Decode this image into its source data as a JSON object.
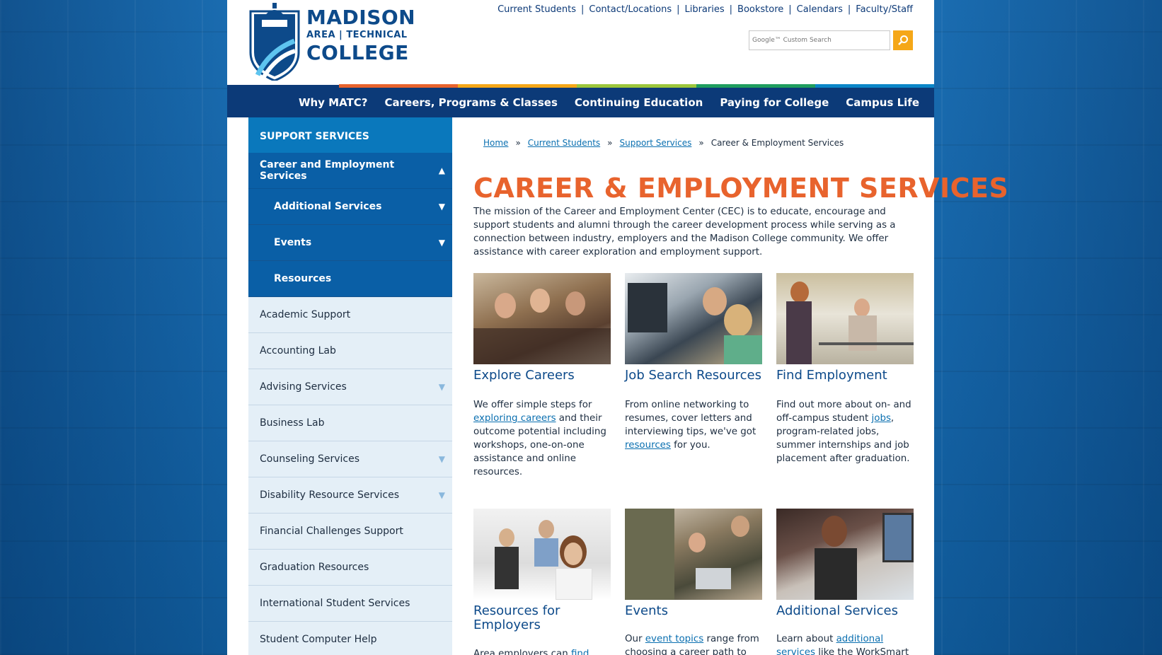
{
  "logo": {
    "line1": "MADISON",
    "line2": "AREA | TECHNICAL",
    "line3": "COLLEGE"
  },
  "utility_links": [
    "Current Students",
    "Contact/Locations",
    "Libraries",
    "Bookstore",
    "Calendars",
    "Faculty/Staff"
  ],
  "search": {
    "placeholder": "Google™ Custom Search",
    "icon": "search-icon"
  },
  "colorbar": [
    "#e8632d",
    "#f5a718",
    "#9cc63b",
    "#1f9d5e",
    "#0a86c8"
  ],
  "main_nav": [
    "Why MATC?",
    "Careers, Programs & Classes",
    "Continuing Education",
    "Paying for College",
    "Campus Life"
  ],
  "sidebar": {
    "heading": "SUPPORT SERVICES",
    "active": {
      "label": "Career and Employment Services",
      "arrow": "▲"
    },
    "subitems": [
      {
        "label": "Additional Services",
        "arrow": "▼"
      },
      {
        "label": "Events",
        "arrow": "▼"
      },
      {
        "label": "Resources",
        "arrow": ""
      }
    ],
    "items": [
      {
        "label": "Academic Support",
        "arrow": ""
      },
      {
        "label": "Accounting Lab",
        "arrow": ""
      },
      {
        "label": "Advising Services",
        "arrow": "▼"
      },
      {
        "label": "Business Lab",
        "arrow": ""
      },
      {
        "label": "Counseling Services",
        "arrow": "▼"
      },
      {
        "label": "Disability Resource Services",
        "arrow": "▼"
      },
      {
        "label": "Financial Challenges Support",
        "arrow": ""
      },
      {
        "label": "Graduation Resources",
        "arrow": ""
      },
      {
        "label": "International Student Services",
        "arrow": ""
      },
      {
        "label": "Student Computer Help",
        "arrow": ""
      }
    ]
  },
  "breadcrumb": {
    "links": [
      "Home",
      "Current Students",
      "Support Services"
    ],
    "current": "Career & Employment Services",
    "separator": "»"
  },
  "page": {
    "title": "CAREER & EMPLOYMENT SERVICES",
    "intro": "The mission of the Career and Employment Center (CEC) is to educate, encourage and support students and alumni through the career development process while serving as a connection between industry, employers and the Madison College community. We offer assistance with career exploration and employment support."
  },
  "cards": [
    {
      "title": "Explore Careers",
      "pre": "We offer simple steps for ",
      "link": "exploring careers",
      "post": " and their outcome potential including workshops, one-on-one assistance and online resources."
    },
    {
      "title": "Job Search Resources",
      "pre": "From online networking to resumes, cover letters and interviewing tips, we've got ",
      "link": "resources",
      "post": " for you."
    },
    {
      "title": "Find Employment",
      "pre": "Find out more about on- and off-campus student ",
      "link": "jobs",
      "post": ", program-related jobs, summer internships and job placement after graduation."
    },
    {
      "title": "Resources for Employers",
      "pre": "Area employers can ",
      "link": "find",
      "post": ""
    },
    {
      "title": "Events",
      "pre": "Our ",
      "link": "event topics",
      "post": " range from choosing a career path to"
    },
    {
      "title": "Additional Services",
      "pre": "Learn about ",
      "link": "additional services",
      "post": " like the WorkSmart"
    }
  ]
}
